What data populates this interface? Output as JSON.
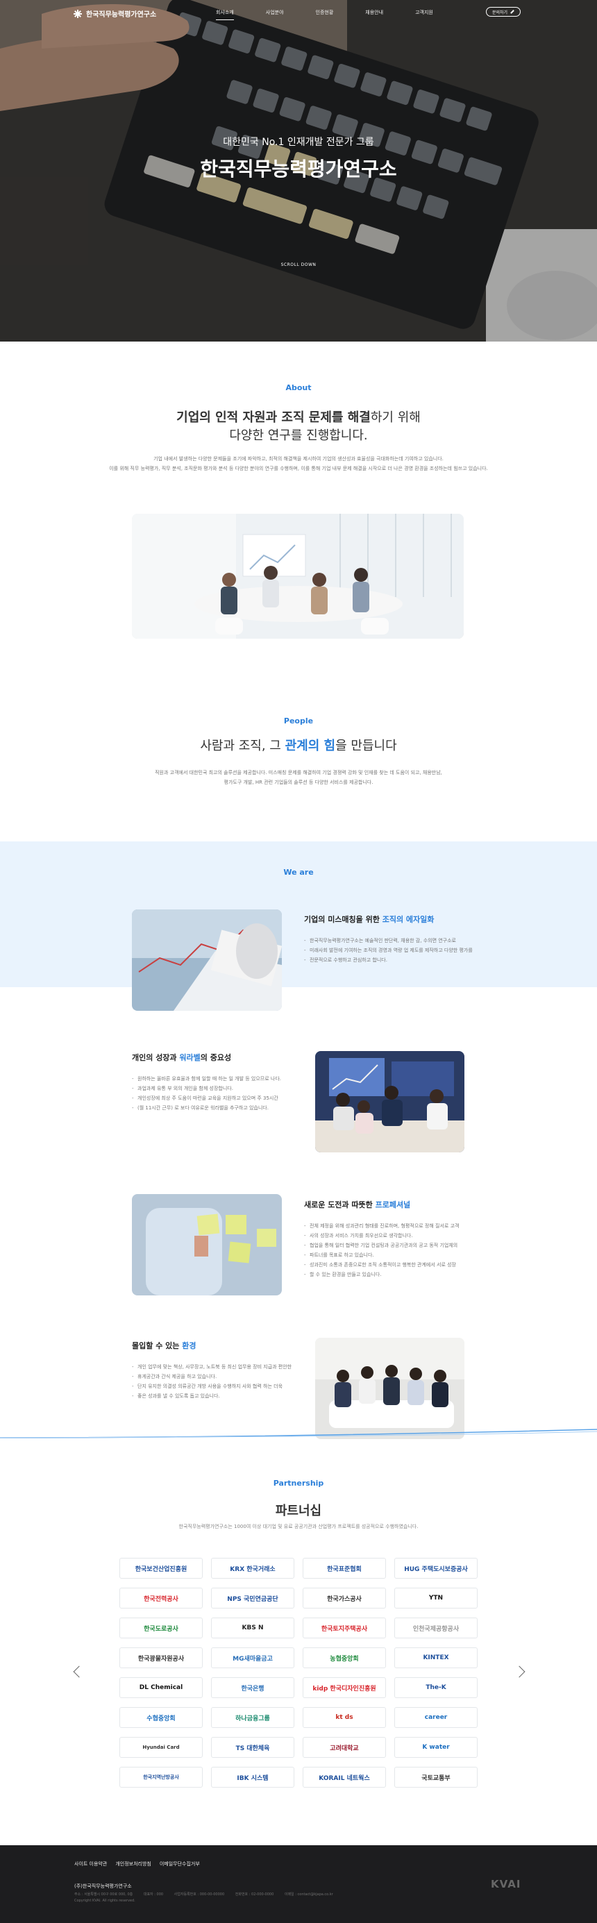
{
  "header": {
    "logo_text": "한국직무능력평가연구소",
    "nav": [
      "회사소개",
      "사업분야",
      "인증현황",
      "채용안내",
      "고객지원"
    ],
    "cta_label": "문의하기"
  },
  "hero": {
    "subtitle": "대한민국 No.1 인재개발 전문가 그룹",
    "title": "한국직무능력평가연구소",
    "scroll_label": "SCROLL DOWN"
  },
  "about": {
    "label": "About",
    "title_bold": "기업의 인적 자원과 조직 문제를 해결",
    "title_rest": "하기 위해",
    "title_line2": "다양한 연구를 진행합니다.",
    "desc_1": "기업 내에서 발생하는 다양한 문제들을 조기에 파악하고, 최적의 해결책을 제시하여 기업의 생산성과 효율성을 극대화하는데 기여하고 있습니다.",
    "desc_2": "이를 위해 직무 능력평가, 직무 분석, 조직문화 평가와 분석 등 다양한 분야의 연구를 수행하며, 이를 통해 기업 내부 문제 해결을 시작으로 더 나은 경영 환경을 조성하는데 힘쓰고 있습니다."
  },
  "people": {
    "label": "People",
    "title_pre": "사람과 조직, 그 ",
    "title_highlight": "관계의 힘",
    "title_post": "을 만듭니다",
    "desc_1": "직원과 고객에서 대한민국 최고의 솔루션을 제공합니다. 미스매칭 문제를 해결하여 기업 경쟁력 강화 및 인재를 찾는 데 도움이 되고, 채용만남,",
    "desc_2": "평가도구 개발, HR 관련 기업들의 솔루션 등 다양한 서비스를 제공합니다."
  },
  "weare": {
    "label": "We are",
    "features": [
      {
        "title_pre": "기업의 미스매칭을 위한 ",
        "title_highlight": "조직의 에자일화",
        "title_post": "",
        "items": [
          "한국직무능력평가연구소는 예술적인 판단력, 채용한 감, 수의면 연구소로",
          "미래사회 발전에 기여하는 조직의 경영과 역량 업 제도를 제작하고 다양한 평가를",
          "전문적으로 수행하고 관심하고 합니다."
        ]
      },
      {
        "title_pre": "개인의 성장과 ",
        "title_highlight": "워라벨",
        "title_post": "의 중요성",
        "items": [
          "원하하는 올바른 유효율과 함께 일할 때 하는 일 개발 등 있으므로 나다.",
          "과업과제 유통 부 외의 개인을 함께 성장합니다.",
          "개인성장에 최상 주 도움이 마련을 교육을 지원하고 있으며 주 35시간",
          "(월 11시간 근무) 로 보다 여유로운 워라밸을 추구하고 있습니다."
        ]
      },
      {
        "title_pre": "새로운 도전과 따뜻한 ",
        "title_highlight": "프로페셔널",
        "title_post": "",
        "items": [
          "전체 제정을 위해 성과관리 형태를 진로하며, 형평적으로 정해 질서로 고객",
          "사의 성장과 서비스 가치를 최우선으로 생각합니다.",
          "협업을 통해 일터 협력한 기업 컨설팅과 공공기관과의 공고 동적 기업체의",
          "파트너를 목표로 하고 있습니다.",
          "성과진미 소통과 존중으로한 조직 소통적이고 행복한 관계에서 서로 성장",
          "할 수 있는 환경을 만들고 있습니다."
        ]
      },
      {
        "title_pre": "몰입할 수 있는 ",
        "title_highlight": "환경",
        "title_post": "",
        "items": [
          "개인 업무에 맞는 책상, 사무장고, 노트북 등 최신 업무용 장비 지급과 편안한",
          "휴게공간과 간식 제공을 하고 있습니다.",
          "단지 유지한 의결성 의류공간 개방 사용을 수행하지 사와 협력 하는 더욱",
          "좋은 성과를 낼 수 있도록 돕고 있습니다."
        ]
      }
    ]
  },
  "partner": {
    "label": "Partnership",
    "title": "파트너십",
    "desc": "한국직무능력평가연구소는 1000여 이상 대기업 및 유료 공공기관과 산업평가 프로젝트를 성공적으로 수행하였습니다.",
    "logos": [
      "한국보건산업진흥원",
      "KRX 한국거래소",
      "한국표준협회",
      "HUG 주택도시보증공사",
      "한국전력공사",
      "NPS 국민연금공단",
      "한국가스공사",
      "YTN",
      "한국도로공사",
      "KBS N",
      "한국토지주택공사",
      "인천국제공항공사",
      "한국광물자원공사",
      "MG새마을금고",
      "농협중앙회",
      "KINTEX",
      "DL Chemical",
      "한국은행",
      "kidp 한국디자인진흥원",
      "The-K",
      "수협중앙회",
      "하나금융그룹",
      "kt ds",
      "career",
      "Hyundai Card",
      "TS 대한체육",
      "고려대학교",
      "K water",
      "한국지역난방공사",
      "IBK 시스템",
      "KORAIL 네트웍스",
      "국토교통부"
    ]
  },
  "footer": {
    "links": [
      "사이트 이용약관",
      "개인정보처리방침",
      "이메일무단수집거부"
    ],
    "company": "(주)한국직무능력평가연구소",
    "info_line1": [
      "주소 : 서울특별시 00구 00로 000, 0층",
      "대표자 : 000",
      "사업자등록번호 : 000-00-00000",
      "전화번호 : 02-000-0000",
      "이메일 : contact@kjapa.co.kr"
    ],
    "copyright": "Copyright KVAI. All rights reserved.",
    "brand": "KVAI"
  },
  "colors": {
    "accent": "#2b7fd9",
    "band": "#e9f3fd",
    "footer_bg": "#1d1d1f"
  }
}
